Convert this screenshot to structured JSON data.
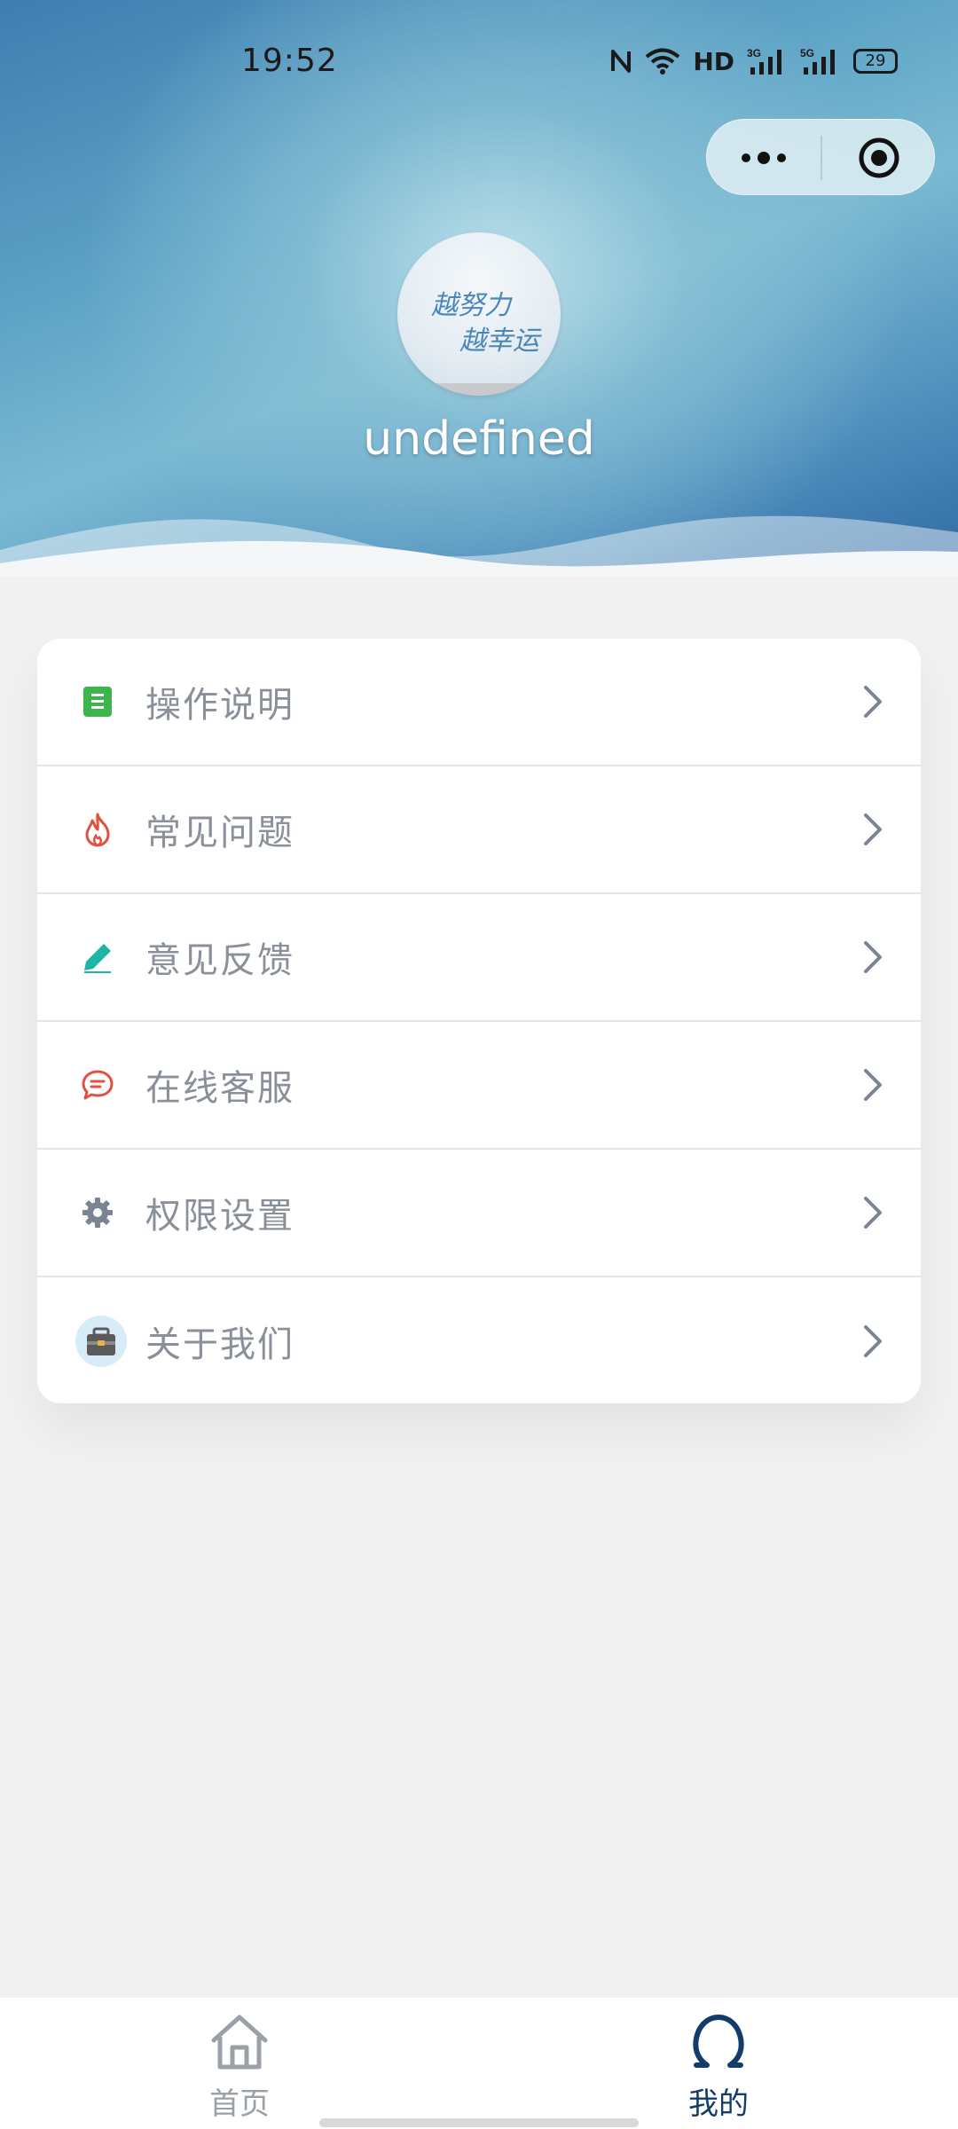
{
  "status_bar": {
    "time": "19:52",
    "network_label": "HD",
    "signal1_label": "3G",
    "signal2_label": "5G",
    "battery": "29"
  },
  "profile": {
    "username": "undefined",
    "avatar_text": [
      "越努力",
      "越幸运"
    ]
  },
  "menu": {
    "items": [
      {
        "label": "操作说明",
        "icon": "document-icon",
        "color": "#3cb64a"
      },
      {
        "label": "常见问题",
        "icon": "flame-icon",
        "color": "#e0523f"
      },
      {
        "label": "意见反馈",
        "icon": "pencil-icon",
        "color": "#1fb5a6"
      },
      {
        "label": "在线客服",
        "icon": "chat-bubble-icon",
        "color": "#e0523f"
      },
      {
        "label": "权限设置",
        "icon": "gear-icon",
        "color": "#7a8591"
      },
      {
        "label": "关于我们",
        "icon": "toolbox-icon",
        "color": "#8fb7d8"
      }
    ]
  },
  "tabbar": {
    "home_label": "首页",
    "mine_label": "我的",
    "active_color": "#123c6b",
    "inactive_color": "#9aa0a6"
  }
}
